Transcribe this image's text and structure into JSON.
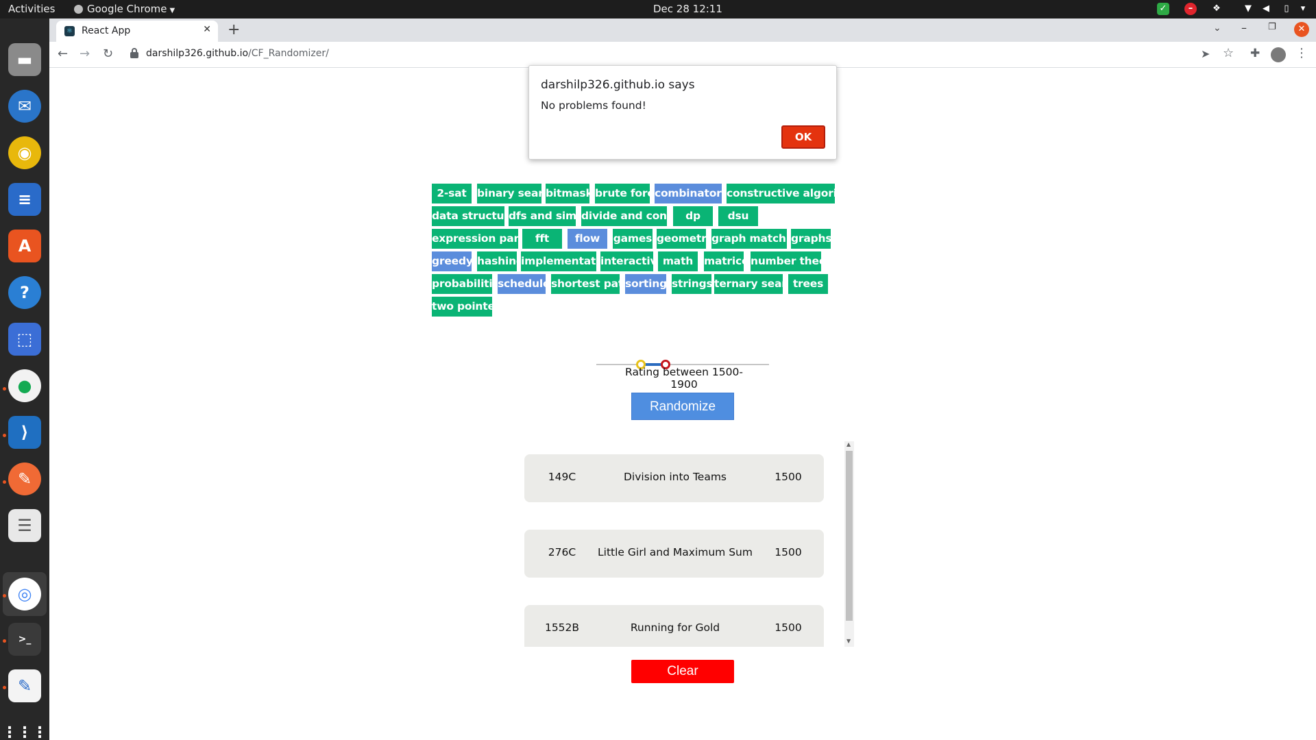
{
  "system": {
    "activities": "Activities",
    "app_menu": "Google Chrome",
    "clock": "Dec 28  12:11"
  },
  "browser": {
    "tab_title": "React App",
    "url_host": "darshilp326.github.io",
    "url_path": "/CF_Randomizer/"
  },
  "alert": {
    "title": "darshilp326.github.io says",
    "message": "No problems found!",
    "ok_label": "OK"
  },
  "tags": [
    {
      "label": "2-sat",
      "selected": false
    },
    {
      "label": "binary search",
      "selected": false
    },
    {
      "label": "bitmasks",
      "selected": false
    },
    {
      "label": "brute force",
      "selected": false
    },
    {
      "label": "combinatorics",
      "selected": true
    },
    {
      "label": "constructive algorithms",
      "selected": false
    },
    {
      "label": "data structures",
      "selected": false
    },
    {
      "label": "dfs and similar",
      "selected": false
    },
    {
      "label": "divide and conquer",
      "selected": false
    },
    {
      "label": "dp",
      "selected": false
    },
    {
      "label": "dsu",
      "selected": false
    },
    {
      "label": "expression parsing",
      "selected": false
    },
    {
      "label": "fft",
      "selected": false
    },
    {
      "label": "flow",
      "selected": true
    },
    {
      "label": "games",
      "selected": false
    },
    {
      "label": "geometry",
      "selected": false
    },
    {
      "label": "graph matchings",
      "selected": false
    },
    {
      "label": "graphs",
      "selected": false
    },
    {
      "label": "greedy",
      "selected": true
    },
    {
      "label": "hashing",
      "selected": false
    },
    {
      "label": "implementation",
      "selected": false
    },
    {
      "label": "interactive",
      "selected": false
    },
    {
      "label": "math",
      "selected": false
    },
    {
      "label": "matrices",
      "selected": false
    },
    {
      "label": "number theory",
      "selected": false
    },
    {
      "label": "probabilities",
      "selected": false
    },
    {
      "label": "schedules",
      "selected": true
    },
    {
      "label": "shortest paths",
      "selected": false
    },
    {
      "label": "sortings",
      "selected": true
    },
    {
      "label": "strings",
      "selected": false
    },
    {
      "label": "ternary search",
      "selected": false
    },
    {
      "label": "trees",
      "selected": false
    },
    {
      "label": "two pointers",
      "selected": false
    }
  ],
  "rating": {
    "text": "Rating between 1500-1900",
    "min": 1500,
    "max": 1900
  },
  "randomize_label": "Randomize",
  "problems": [
    {
      "id": "149C",
      "name": "Division into Teams",
      "rating": "1500"
    },
    {
      "id": "276C",
      "name": "Little Girl and Maximum Sum",
      "rating": "1500"
    },
    {
      "id": "1552B",
      "name": "Running for Gold",
      "rating": "1500"
    }
  ],
  "clear_label": "Clear",
  "colors": {
    "tag_default": "#0ab475",
    "tag_selected": "#5b8ddc",
    "randomize": "#4f8ee0",
    "clear": "#ff0000",
    "alert_ok": "#e4330f"
  }
}
